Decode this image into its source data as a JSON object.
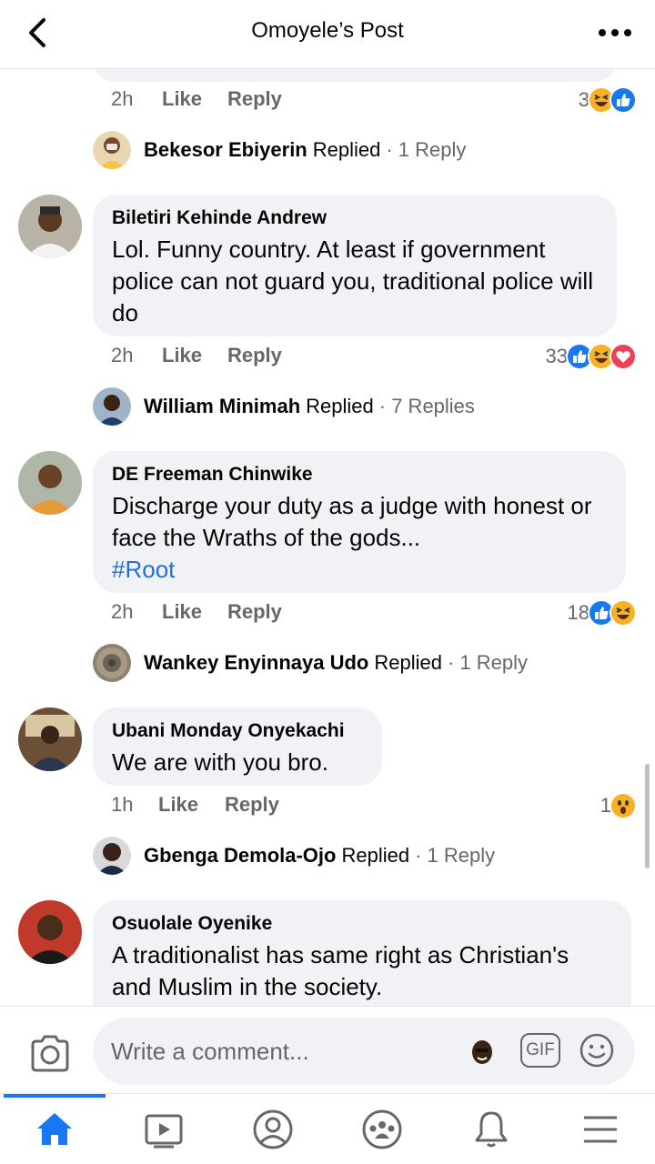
{
  "header": {
    "title": "Omoyele’s Post"
  },
  "top_partial": {
    "time": "2h",
    "like": "Like",
    "reply": "Reply",
    "reaction_count": "3",
    "reactions": [
      "haha",
      "like"
    ],
    "replied": {
      "name": "Bekesor Ebiyerin",
      "verb": "Replied",
      "count": "· 1 Reply"
    }
  },
  "comments": [
    {
      "name": "Biletiri Kehinde Andrew",
      "text": "Lol. Funny country. At least if government police can not guard you, traditional police will do",
      "hashtag": "",
      "time": "2h",
      "like": "Like",
      "reply": "Reply",
      "reaction_count": "33",
      "reactions": [
        "like",
        "haha",
        "love"
      ],
      "replied": {
        "name": "William Minimah",
        "verb": "Replied",
        "count": "· 7 Replies"
      }
    },
    {
      "name": "DE Freeman Chinwike",
      "text": "Discharge your duty as a judge with honest or face the Wraths of the gods...",
      "hashtag": "#Root",
      "time": "2h",
      "like": "Like",
      "reply": "Reply",
      "reaction_count": "18",
      "reactions": [
        "like",
        "haha"
      ],
      "replied": {
        "name": "Wankey Enyinnaya Udo",
        "verb": "Replied",
        "count": "· 1 Reply"
      }
    },
    {
      "name": "Ubani Monday Onyekachi",
      "text": "We are with you bro.",
      "hashtag": "",
      "time": "1h",
      "like": "Like",
      "reply": "Reply",
      "reaction_count": "1",
      "reactions": [
        "wow"
      ],
      "replied": {
        "name": "Gbenga Demola-Ojo",
        "verb": "Replied",
        "count": "· 1 Reply"
      }
    },
    {
      "name": "Osuolale Oyenike",
      "text": "A traditionalist has same right as Christian's and Muslim in the society.",
      "hashtag": ""
    }
  ],
  "composer": {
    "placeholder": "Write a comment...",
    "gif_label": "GIF"
  },
  "tabs": [
    "home-icon",
    "video-icon",
    "profile-icon",
    "groups-icon",
    "notifications-icon",
    "menu-icon"
  ],
  "colors": {
    "accent": "#1877f2",
    "bubble": "#f0f2f5",
    "muted": "#65676b",
    "hashtag": "#216fdb"
  }
}
